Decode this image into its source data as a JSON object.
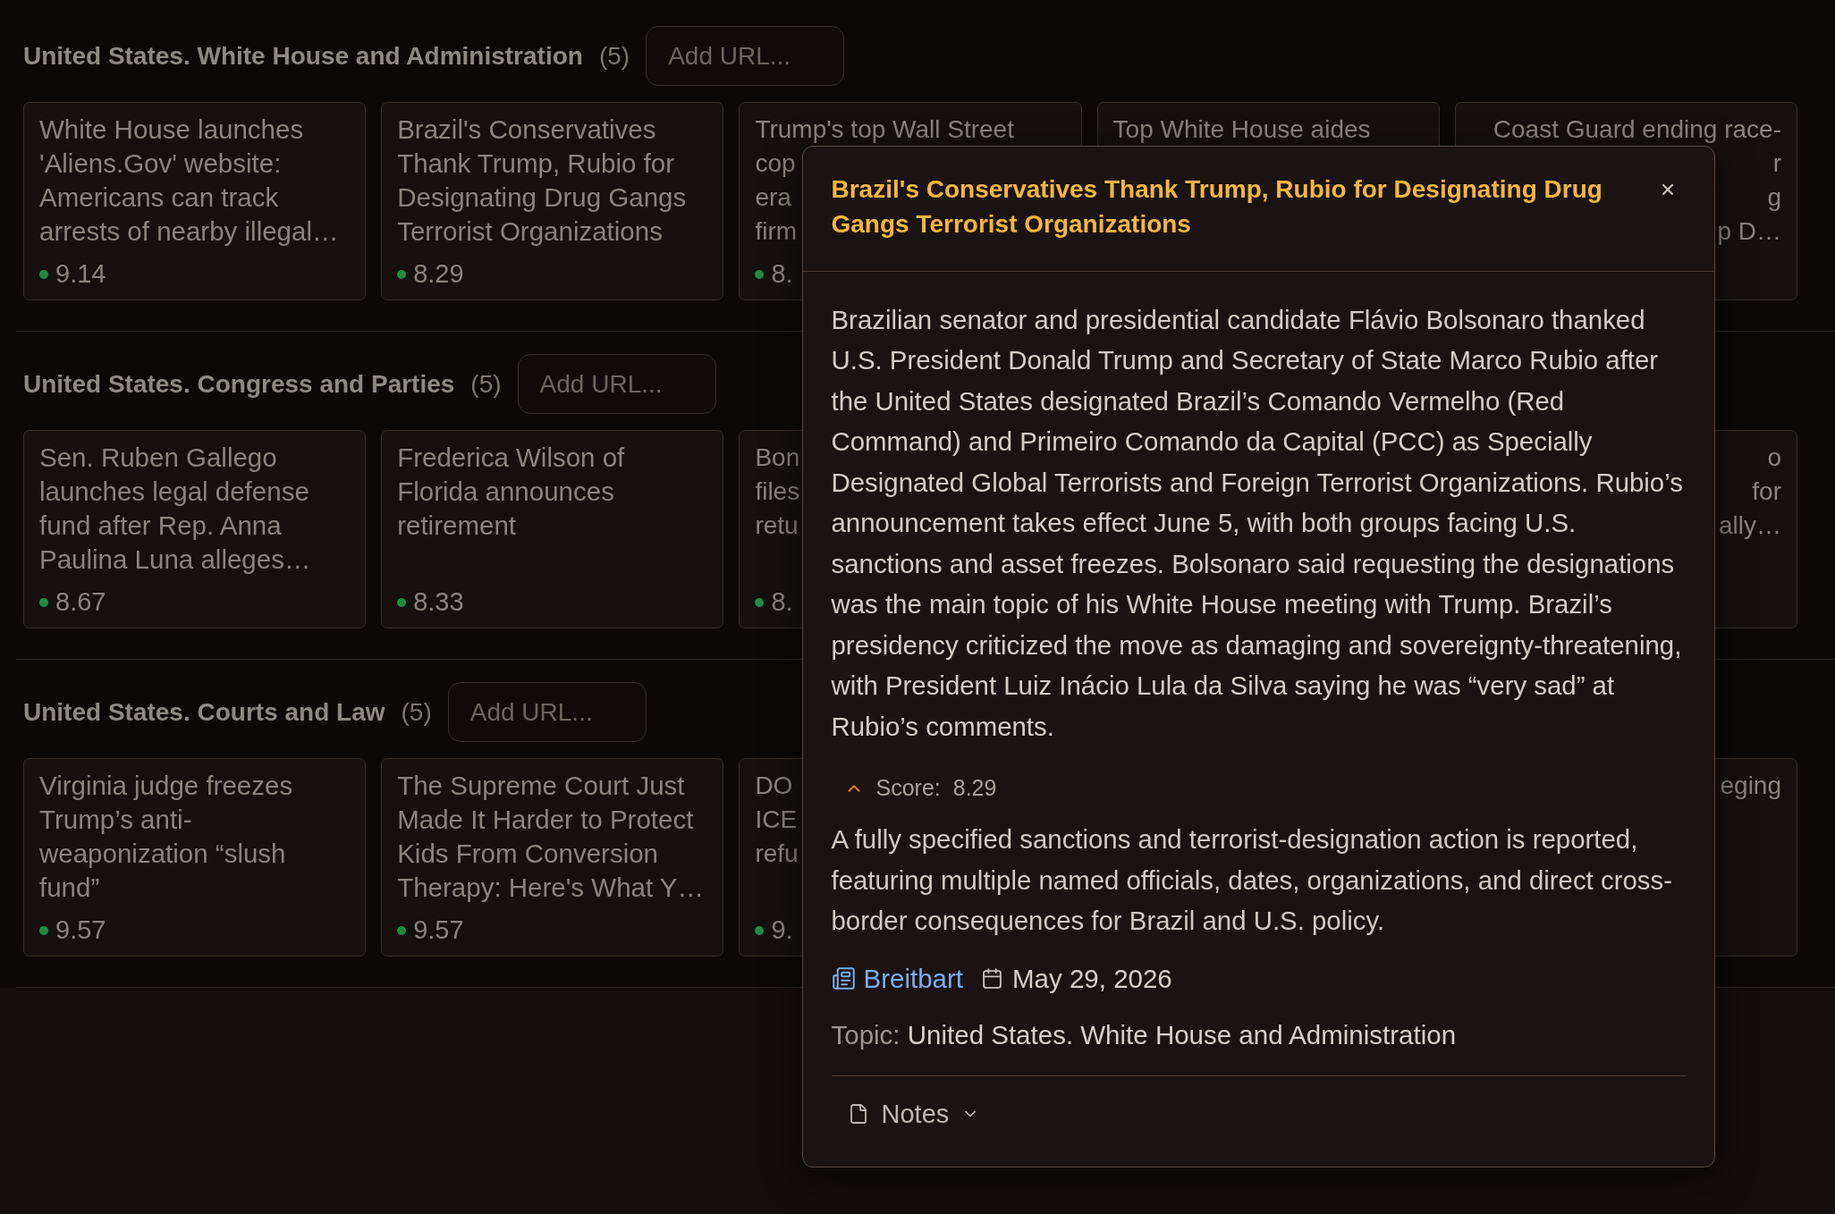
{
  "sections": [
    {
      "title": "United States. White House and Administration",
      "count": "(5)",
      "url_input": {
        "placeholder": "Add URL..."
      },
      "cards": [
        {
          "kind": "full",
          "title": "White House launches 'Aliens.Gov' website: Americans can track arrests of nearby illegal…",
          "score": "9.14"
        },
        {
          "kind": "full",
          "title": "Brazil's Conservatives Thank Trump, Rubio for Designating Drug Gangs Terrorist Organizations",
          "score": "8.29"
        },
        {
          "kind": "head",
          "lines": [
            "Trump's top Wall Street",
            "cop",
            "era",
            "firm"
          ],
          "score": "8."
        },
        {
          "kind": "head",
          "lines": [
            "Top White House aides"
          ]
        },
        {
          "kind": "tail",
          "lines": [
            "Coast Guard ending race-",
            "r",
            "g",
            "p D…"
          ]
        }
      ]
    },
    {
      "title": "United States. Congress and Parties",
      "count": "(5)",
      "url_input": {
        "placeholder": "Add URL..."
      },
      "cards": [
        {
          "kind": "full",
          "title": "Sen. Ruben Gallego launches legal defense fund after Rep. Anna Paulina Luna alleges…",
          "score": "8.67"
        },
        {
          "kind": "full",
          "title": "Frederica Wilson of Florida announces retirement",
          "score": "8.33"
        },
        {
          "kind": "head",
          "lines": [
            "Bon",
            "files",
            "retu"
          ],
          "score": "8."
        },
        {
          "kind": "tail",
          "lines": [
            "o",
            "for",
            "ally…"
          ]
        }
      ]
    },
    {
      "title": "United States. Courts and Law",
      "count": "(5)",
      "url_input": {
        "placeholder": "Add URL..."
      },
      "cards": [
        {
          "kind": "full",
          "title": "Virginia judge freezes Trump’s anti-weaponization “slush fund”",
          "score": "9.57"
        },
        {
          "kind": "full",
          "title": "The Supreme Court Just Made It Harder to Protect Kids From Conversion Therapy: Here's What Y…",
          "score": "9.57"
        },
        {
          "kind": "head",
          "lines": [
            "DO",
            "ICE",
            "refu"
          ],
          "score": "9."
        },
        {
          "kind": "tail",
          "lines": [
            "eging"
          ]
        }
      ]
    }
  ],
  "article_popup": {
    "title": "Brazil's Conservatives Thank Trump, Rubio for Designating Drug Gangs Terrorist Organizations",
    "summary": "Brazilian senator and presidential candidate Flávio Bolsonaro thanked U.S. President Donald Trump and Secretary of State Marco Rubio after the United States designated Brazil’s Comando Vermelho (Red Command) and Primeiro Comando da Capital (PCC) as Specially Designated Global Terrorists and Foreign Terrorist Organizations. Rubio’s announcement takes effect June 5, with both groups facing U.S. sanctions and asset freezes. Bolsonaro said requesting the designations was the main topic of his White House meeting with Trump. Brazil’s presidency criticized the move as damaging and sovereignty-threatening, with President Luiz Inácio Lula da Silva saying he was “very sad” at Rubio’s comments.",
    "score": {
      "label": "Score:",
      "value": "8.29",
      "expanded": true,
      "explanation": "A fully specified sanctions and terrorist-designation action is reported, featuring multiple named officials, dates, organizations, and direct cross-border consequences for Brazil and U.S. policy."
    },
    "source": "Breitbart",
    "date": "May 29, 2026",
    "topic": {
      "label": "Topic:",
      "value": "United States. White House and Administration"
    },
    "notes": {
      "label": "Notes",
      "expanded": false
    }
  }
}
